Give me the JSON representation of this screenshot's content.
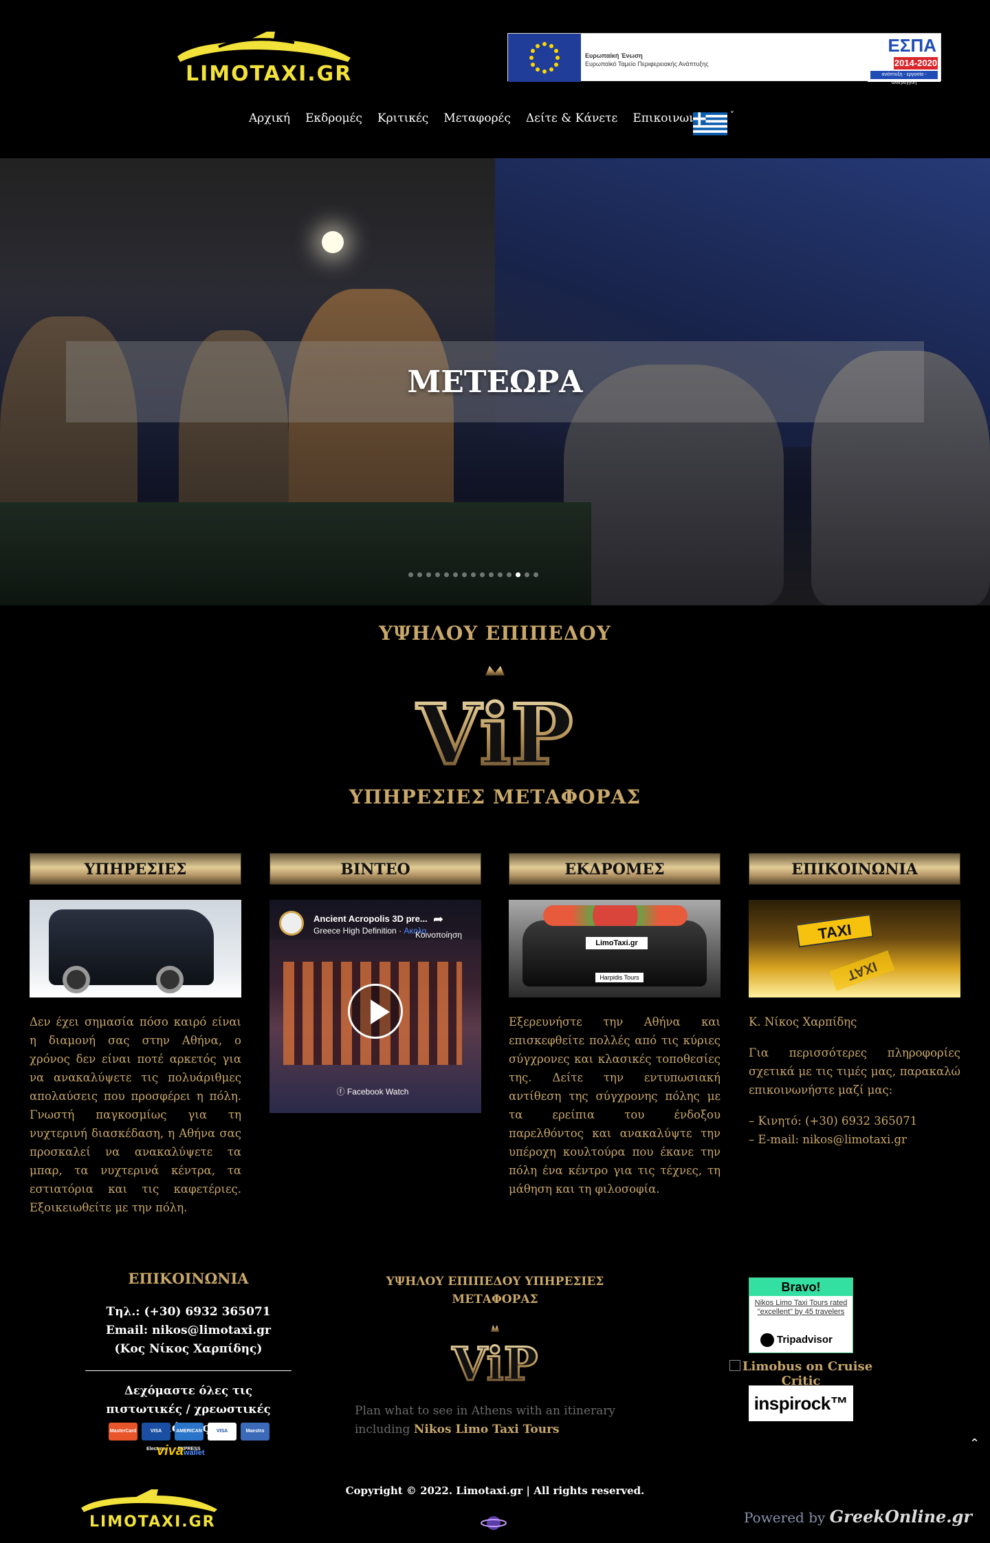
{
  "header": {
    "logo_text": "LIMOTAXI.GR",
    "espa": {
      "eu_text_1": "Ευρωπαϊκή Ένωση",
      "eu_text_2": "Ευρωπαϊκό Ταμείο Περιφερειακής Ανάπτυξης",
      "title": "ΕΣΠΑ",
      "years": "2014-2020",
      "sub": "ανάπτυξη - εργασία - αλληλεγγύη"
    },
    "nav": [
      "Αρχική",
      "Εκδρομές",
      "Κριτικές",
      "Μεταφορές",
      "Δείτε & Κάνετε",
      "Επικοινωνία"
    ],
    "language_flag": "greece-flag-icon"
  },
  "hero": {
    "title": "ΜΕΤΕΩΡΑ",
    "slides_count": 15,
    "active_slide": 12
  },
  "vip": {
    "top": "ΥΨΗΛΟΥ ΕΠΙΠΕΔΟΥ",
    "logo": "ViP",
    "bottom": "ΥΠΗΡΕΣΙΕΣ ΜΕΤΑΦΟΡΑΣ"
  },
  "columns": {
    "services": {
      "title": "ΥΠΗΡΕΣΙΕΣ",
      "text": "Δεν έχει σημασία πόσο καιρό είναι η διαμονή σας στην Αθήνα, ο χρόνος δεν είναι ποτέ αρκετός για να ανακαλύψετε τις πολυάριθμες απολαύσεις που προσφέρει η πόλη. Γνωστή παγκοσμίως για τη νυχτερινή διασκέδαση, η Αθήνα σας προσκαλεί να ανακαλύψετε τα μπαρ, τα νυχτερινά κέντρα, τα εστιατόρια και τις καφετέριες. Εξοικειωθείτε με την πόλη."
    },
    "video": {
      "title": "ΒΙΝΤΕΟ",
      "video_title": "Ancient Acropolis 3D pre...",
      "channel": "Greece High Definition",
      "follow": "Ακολο",
      "share_label": "Κοινοποίηση",
      "fb_watch": "Facebook Watch"
    },
    "tours": {
      "title": "ΕΚΔΡΟΜΕΣ",
      "plate": "LimoTaxi.gr",
      "plate2": "Harpidis Tours",
      "text": "Εξερευνήστε την Αθήνα και επισκεφθείτε πολλές από τις κύριες σύγχρονες και κλασικές τοποθεσίες της. Δείτε την εντυπωσιακή αντίθεση της σύγχρονης πόλης με τα ερείπια του ένδοξου παρελθόντος και ανακαλύψτε την υπέροχη κουλτούρα που έκανε την πόλη ένα κέντρο για τις τέχνες, τη μάθηση και τη φιλοσοφία."
    },
    "contact": {
      "title": "ΕΠΙΚΟΙΝΩΝΙΑ",
      "taxi_sign": "TAXI",
      "name": "Κ. Νίκος Χαρπίδης",
      "info": "Για περισσότερες πληροφορίες σχετικά με τις τιμές μας, παρακαλώ επικοινωνήστε μαζί μας:",
      "mobile": "– Κινητό: (+30) 6932 365071",
      "email": "– E-mail: nikos@limotaxi.gr"
    }
  },
  "footer": {
    "contact_title": "ΕΠΙΚΟΙΝΩΝΙΑ",
    "phone": "Τηλ.: (+30) 6932 365071",
    "email": "Email: nikos@limotaxi.gr",
    "person": "(Κος Νίκος Χαρπίδης)",
    "cards_text": "Δεχόμαστε όλες τις πιστωτικές / χρεωστικές κάρτες:",
    "cards": [
      {
        "name": "MasterCard",
        "color": "#e8552a"
      },
      {
        "name": "VISA Electron",
        "color": "#1a4fa3"
      },
      {
        "name": "AMERICAN EXPRESS",
        "color": "#2a74c9"
      },
      {
        "name": "VISA",
        "color": "#ffffff"
      },
      {
        "name": "Maestro",
        "color": "#3b6bb8"
      }
    ],
    "viva": "viva",
    "viva_wallet": "wallet",
    "mid_title": "ΥΨΗΛΟΥ ΕΠΙΠΕΔΟΥ ΥΠΗΡΕΣΙΕΣ ΜΕΤΑΦΟΡΑΣ",
    "plan_text": "Plan what to see in Athens with an itinerary including",
    "plan_link": "Nikos Limo Taxi Tours",
    "tripadvisor": {
      "bravo": "Bravo!",
      "rated": "Nikos Limo Taxi Tours rated \"excellent\" by 45 travelers",
      "brand": "Tripadvisor"
    },
    "cruise_critic": "Limobus on Cruise Critic",
    "inspirock": "inspirock™",
    "copyright": "Copyright © 2022. Limotaxi.gr | All rights reserved.",
    "logo_text": "LIMOTAXI.GR",
    "powered_by": "Powered by",
    "powered_brand": "GreekOnline.gr"
  }
}
